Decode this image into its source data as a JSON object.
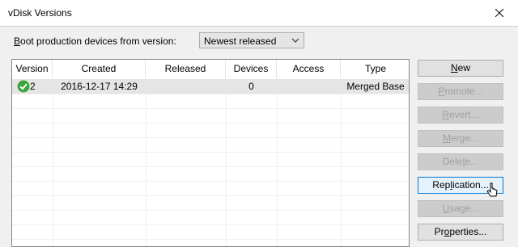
{
  "window": {
    "title": "vDisk Versions",
    "close_label": "✕"
  },
  "boot": {
    "label_prefix": "",
    "label_accel": "B",
    "label_rest": "oot production devices from version:",
    "selected": "Newest released"
  },
  "table": {
    "columns": [
      "Version",
      "Created",
      "Released",
      "Devices",
      "Access",
      "Type"
    ],
    "rows": [
      {
        "status_icon": "green-check-icon",
        "version": "2",
        "created": "2016-12-17 14:29",
        "released": "",
        "devices": "0",
        "access": "",
        "type": "Merged Base"
      }
    ]
  },
  "buttons": {
    "new": {
      "accel": "N",
      "rest": "ew"
    },
    "promote": {
      "accel": "P",
      "rest": "romote..."
    },
    "revert": {
      "accel": "R",
      "rest": "evert..."
    },
    "merge": {
      "accel": "M",
      "rest": "erge..."
    },
    "delete": {
      "pre": "Dele",
      "accel": "t",
      "rest": "e..."
    },
    "replication": {
      "pre": "Rep",
      "accel": "l",
      "rest": "ication..."
    },
    "usage": {
      "accel": "U",
      "rest": "sage..."
    },
    "properties": {
      "pre": "Pr",
      "accel": "o",
      "rest": "perties..."
    }
  },
  "colors": {
    "check_green": "#3aa63a",
    "hover_border": "#0078d7"
  }
}
